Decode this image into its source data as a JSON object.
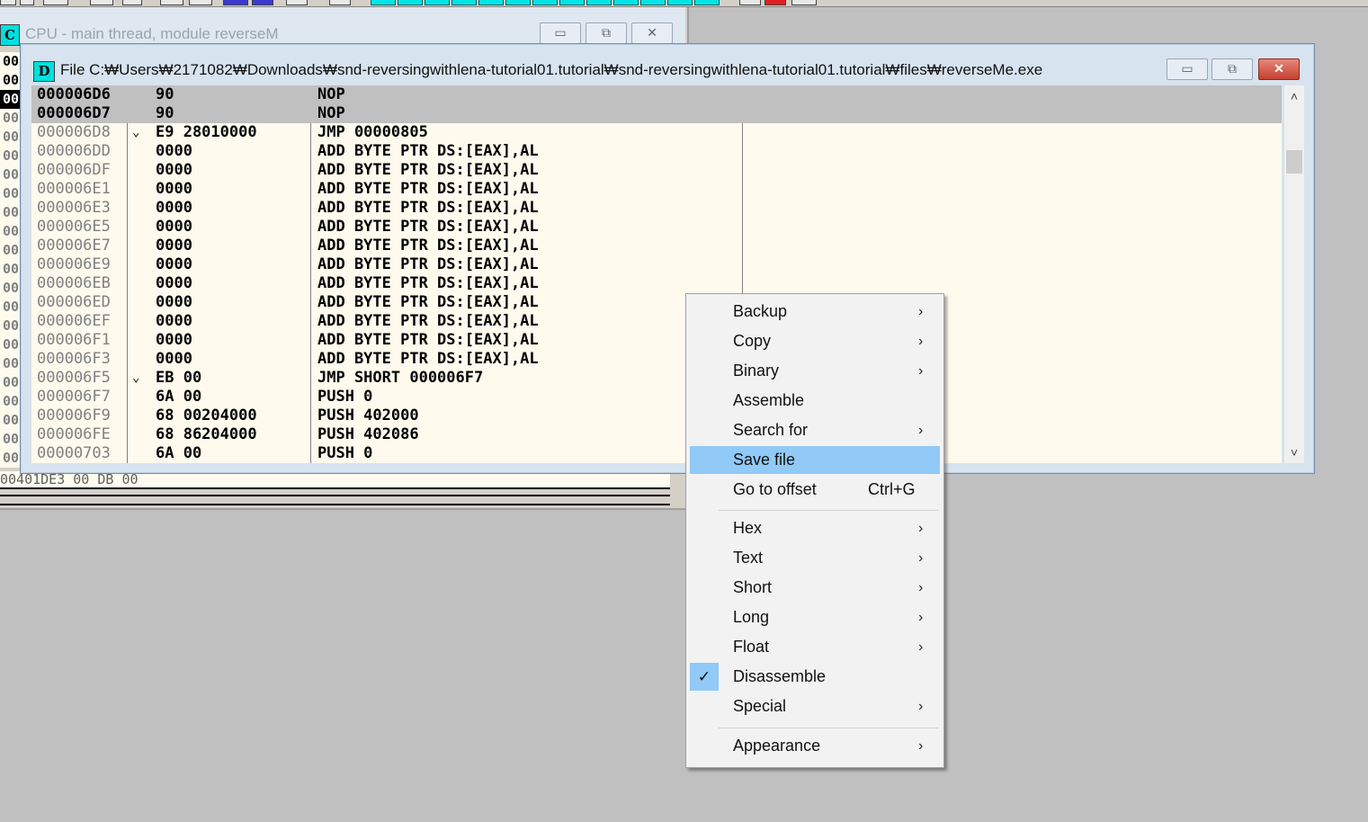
{
  "cpu_window": {
    "icon_letter": "C",
    "title": "CPU - main thread, module reverseM",
    "min_glyph": "▭",
    "max_glyph": "⧉",
    "close_glyph": "✕",
    "left_strip": [
      "00",
      "00",
      "00",
      "00",
      "00",
      "00",
      "00",
      "00",
      "00",
      "00",
      "00",
      "00",
      "00",
      "00",
      "00",
      "00",
      "00",
      "00",
      "00",
      "00",
      "00",
      "00"
    ],
    "bottom_line": "00401DE3   00         DB 00"
  },
  "file_window": {
    "icon_letter": "D",
    "title": "File C:₩Users₩2171082₩Downloads₩snd-reversingwithlena-tutorial01.tutorial₩snd-reversingwithlena-tutorial01.tutorial₩files₩reverseMe.exe",
    "min_glyph": "▭",
    "max_glyph": "⧉",
    "close_glyph": "✕"
  },
  "disasm": {
    "rows": [
      {
        "addr": "000006D6",
        "mark": "",
        "hex": "90",
        "cmd": "NOP"
      },
      {
        "addr": "000006D7",
        "mark": "",
        "hex": "90",
        "cmd": "NOP"
      },
      {
        "addr": "000006D8",
        "mark": "⌄",
        "hex": "E9 28010000",
        "cmd": "JMP 00000805"
      },
      {
        "addr": "000006DD",
        "mark": "",
        "hex": "0000",
        "cmd": "ADD BYTE PTR DS:[EAX],AL"
      },
      {
        "addr": "000006DF",
        "mark": "",
        "hex": "0000",
        "cmd": "ADD BYTE PTR DS:[EAX],AL"
      },
      {
        "addr": "000006E1",
        "mark": "",
        "hex": "0000",
        "cmd": "ADD BYTE PTR DS:[EAX],AL"
      },
      {
        "addr": "000006E3",
        "mark": "",
        "hex": "0000",
        "cmd": "ADD BYTE PTR DS:[EAX],AL"
      },
      {
        "addr": "000006E5",
        "mark": "",
        "hex": "0000",
        "cmd": "ADD BYTE PTR DS:[EAX],AL"
      },
      {
        "addr": "000006E7",
        "mark": "",
        "hex": "0000",
        "cmd": "ADD BYTE PTR DS:[EAX],AL"
      },
      {
        "addr": "000006E9",
        "mark": "",
        "hex": "0000",
        "cmd": "ADD BYTE PTR DS:[EAX],AL"
      },
      {
        "addr": "000006EB",
        "mark": "",
        "hex": "0000",
        "cmd": "ADD BYTE PTR DS:[EAX],AL"
      },
      {
        "addr": "000006ED",
        "mark": "",
        "hex": "0000",
        "cmd": "ADD BYTE PTR DS:[EAX],AL"
      },
      {
        "addr": "000006EF",
        "mark": "",
        "hex": "0000",
        "cmd": "ADD BYTE PTR DS:[EAX],AL"
      },
      {
        "addr": "000006F1",
        "mark": "",
        "hex": "0000",
        "cmd": "ADD BYTE PTR DS:[EAX],AL"
      },
      {
        "addr": "000006F3",
        "mark": "",
        "hex": "0000",
        "cmd": "ADD BYTE PTR DS:[EAX],AL"
      },
      {
        "addr": "000006F5",
        "mark": "⌄",
        "hex": "EB 00",
        "cmd": "JMP SHORT 000006F7"
      },
      {
        "addr": "000006F7",
        "mark": "",
        "hex": "6A 00",
        "cmd": "PUSH 0"
      },
      {
        "addr": "000006F9",
        "mark": "",
        "hex": "68 00204000",
        "cmd": "PUSH 402000"
      },
      {
        "addr": "000006FE",
        "mark": "",
        "hex": "68 86204000",
        "cmd": "PUSH 402086"
      },
      {
        "addr": "00000703",
        "mark": "",
        "hex": "6A 00",
        "cmd": "PUSH 0"
      }
    ]
  },
  "scrollbar": {
    "up_glyph": "˄",
    "down_glyph": "˅"
  },
  "context_menu": {
    "items": [
      {
        "label": "Backup",
        "arrow": "›"
      },
      {
        "label": "Copy",
        "arrow": "›"
      },
      {
        "label": "Binary",
        "arrow": "›"
      },
      {
        "label": "Assemble",
        "arrow": ""
      },
      {
        "label": "Search for",
        "arrow": "›"
      },
      {
        "label": "Save file",
        "arrow": ""
      },
      {
        "label": "Go to offset",
        "arrow": "",
        "shortcut": "Ctrl+G"
      },
      {
        "label": "Hex",
        "arrow": "›"
      },
      {
        "label": "Text",
        "arrow": "›"
      },
      {
        "label": "Short",
        "arrow": "›"
      },
      {
        "label": "Long",
        "arrow": "›"
      },
      {
        "label": "Float",
        "arrow": "›"
      },
      {
        "label": "Disassemble",
        "arrow": "",
        "checked": true,
        "check_glyph": "✓"
      },
      {
        "label": "Special",
        "arrow": "›"
      },
      {
        "label": "Appearance",
        "arrow": "›"
      }
    ]
  }
}
